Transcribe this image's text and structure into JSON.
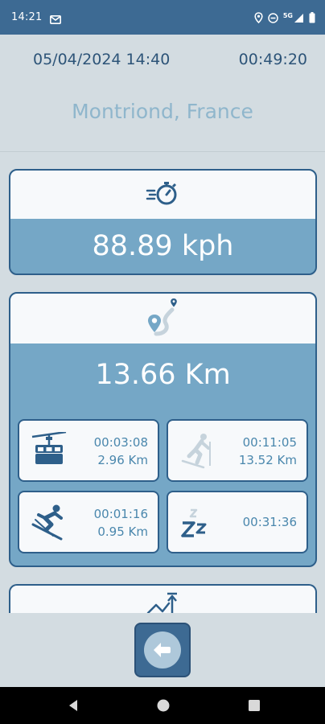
{
  "status_bar": {
    "time": "14:21",
    "network_label": "5G"
  },
  "header": {
    "date_time": "05/04/2024 14:40",
    "duration": "00:49:20",
    "location": "Montriond, France"
  },
  "speed_card": {
    "icon": "stopwatch-speed-icon",
    "value": "88.89 kph"
  },
  "distance_card": {
    "icon": "route-pin-icon",
    "value": "13.66 Km",
    "stats": [
      {
        "icon": "gondola-lift-icon",
        "time": "00:03:08",
        "distance": "2.96 Km"
      },
      {
        "icon": "ski-touring-icon",
        "time": "00:11:05",
        "distance": "13.52 Km"
      },
      {
        "icon": "downhill-skier-icon",
        "time": "00:01:16",
        "distance": "0.95 Km"
      },
      {
        "icon": "sleep-zzz-icon",
        "time": "00:31:36"
      }
    ]
  },
  "partial_card": {
    "icon": "elevation-graph-icon"
  },
  "actions": {
    "back_icon": "back-arrow-icon"
  },
  "colors": {
    "status_bar": "#3d6a93",
    "background": "#d3dce1",
    "card_accent": "#75a7c6",
    "card_border": "#2e5f8a",
    "stat_text": "#4a87ad",
    "location_text": "#8fb6cc"
  }
}
